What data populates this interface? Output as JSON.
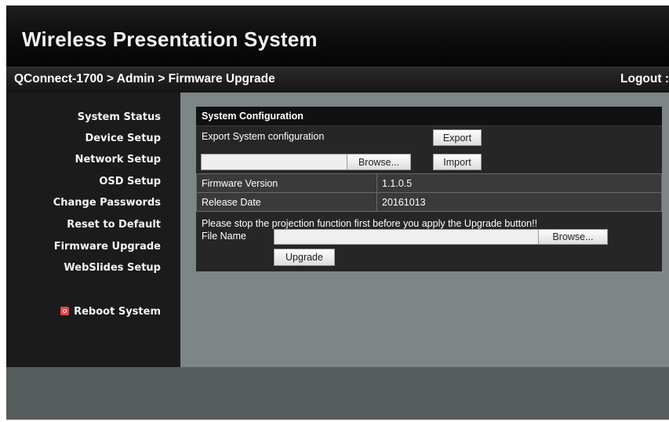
{
  "app": {
    "title": "Wireless Presentation System"
  },
  "breadcrumb": {
    "text": "QConnect-1700 > Admin > Firmware Upgrade",
    "logout": "Logout :"
  },
  "sidebar": {
    "items": [
      {
        "label": "System Status"
      },
      {
        "label": "Device Setup"
      },
      {
        "label": "Network Setup"
      },
      {
        "label": "OSD Setup"
      },
      {
        "label": "Change Passwords"
      },
      {
        "label": "Reset to Default"
      },
      {
        "label": "Firmware Upgrade"
      },
      {
        "label": "WebSlides Setup"
      }
    ],
    "reboot": {
      "label": "Reboot System",
      "icon": "reboot-icon",
      "icon_color": "#e74646"
    }
  },
  "panel": {
    "header": "System Configuration",
    "export_label": "Export System configuration",
    "export_button": "Export",
    "config_file": {
      "value": "",
      "browse": "Browse...",
      "import_button": "Import"
    },
    "firmware_version": {
      "label": "Firmware Version",
      "value": "1.1.0.5"
    },
    "release_date": {
      "label": "Release Date",
      "value": "20161013"
    },
    "upgrade": {
      "notice": "Please stop the projection function first before you apply the Upgrade button!!",
      "file_name_label": "File Name",
      "file_value": "",
      "browse": "Browse...",
      "upgrade_button": "Upgrade"
    }
  }
}
